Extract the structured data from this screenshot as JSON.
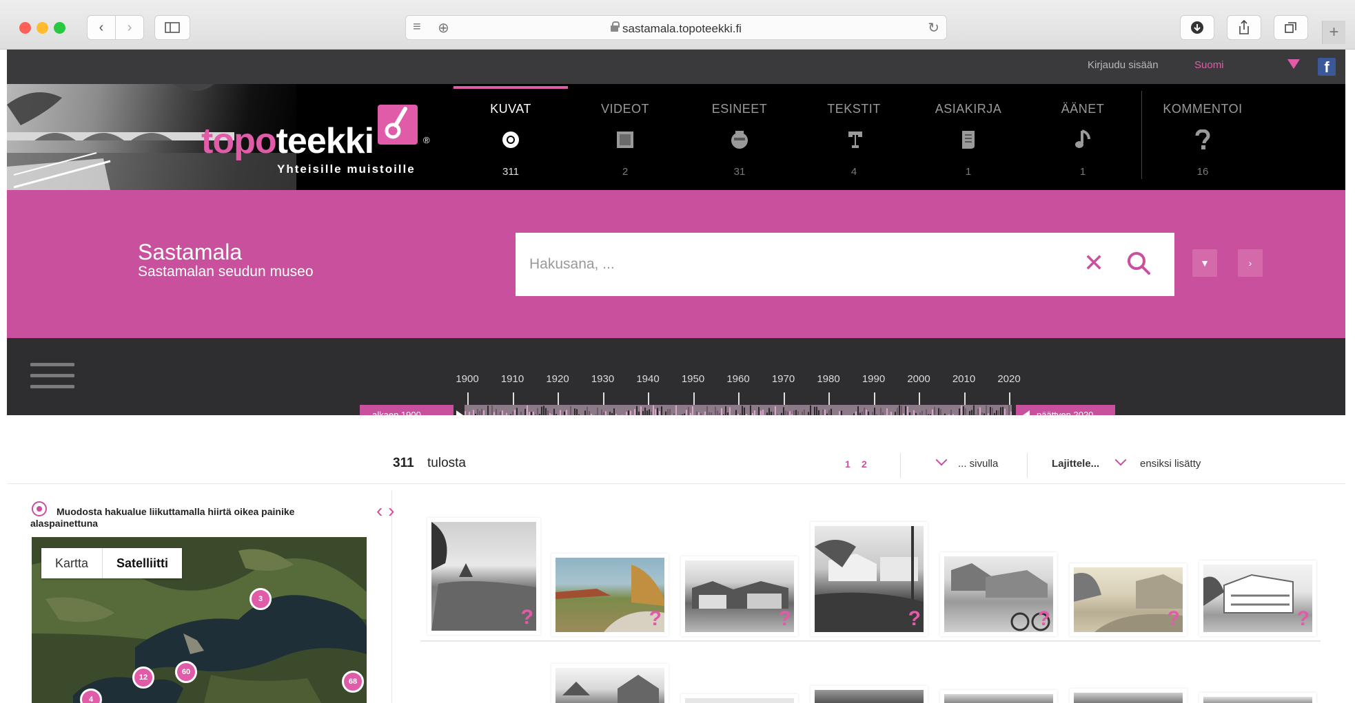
{
  "browser": {
    "url": "sastamala.topoteekki.fi"
  },
  "topbar": {
    "login": "Kirjaudu sisään",
    "language": "Suomi"
  },
  "logo": {
    "part1": "topo",
    "part2": "teekki",
    "registered": "®",
    "tagline": "Yhteisille muistoille"
  },
  "categories": [
    {
      "label": "KUVAT",
      "count": "311",
      "icon": "image-icon",
      "active": true
    },
    {
      "label": "VIDEOT",
      "count": "2",
      "icon": "film-icon"
    },
    {
      "label": "ESINEET",
      "count": "31",
      "icon": "vase-icon"
    },
    {
      "label": "TEKSTIT",
      "count": "4",
      "icon": "text-icon"
    },
    {
      "label": "ASIAKIRJA",
      "count": "1",
      "icon": "document-icon"
    },
    {
      "label": "ÄÄNET",
      "count": "1",
      "icon": "music-note-icon"
    },
    {
      "label": "KOMMENTOI",
      "count": "16",
      "icon": "question-icon"
    }
  ],
  "site": {
    "title": "Sastamala",
    "subtitle": "Sastamalan seudun museo"
  },
  "search": {
    "placeholder": "Hakusana, ..."
  },
  "timeline": {
    "years": [
      "1900",
      "1910",
      "1920",
      "1930",
      "1940",
      "1950",
      "1960",
      "1970",
      "1980",
      "1990",
      "2000",
      "2010",
      "2020"
    ],
    "start_label": "alkaen 1900",
    "end_label": "päättyen 2020"
  },
  "results": {
    "count": "311",
    "count_label": "tulosta",
    "pages": [
      "1",
      "2"
    ],
    "per_page": "... sivulla",
    "sort_label": "Lajittele...",
    "sort_value": "ensiksi lisätty"
  },
  "map": {
    "hint": "Muodosta hakualue liikuttamalla hiirtä oikea painike alaspainettuna",
    "map_tab": "Kartta",
    "satellite_tab": "Satelliitti",
    "markers": [
      "3",
      "12",
      "60",
      "68",
      "4"
    ]
  },
  "thumbnails": {
    "badge": "?"
  },
  "colors": {
    "accent": "#c8509c",
    "accent_light": "#e05ca8",
    "header_bg": "#000000",
    "timeline_bg": "#2e2e30"
  }
}
